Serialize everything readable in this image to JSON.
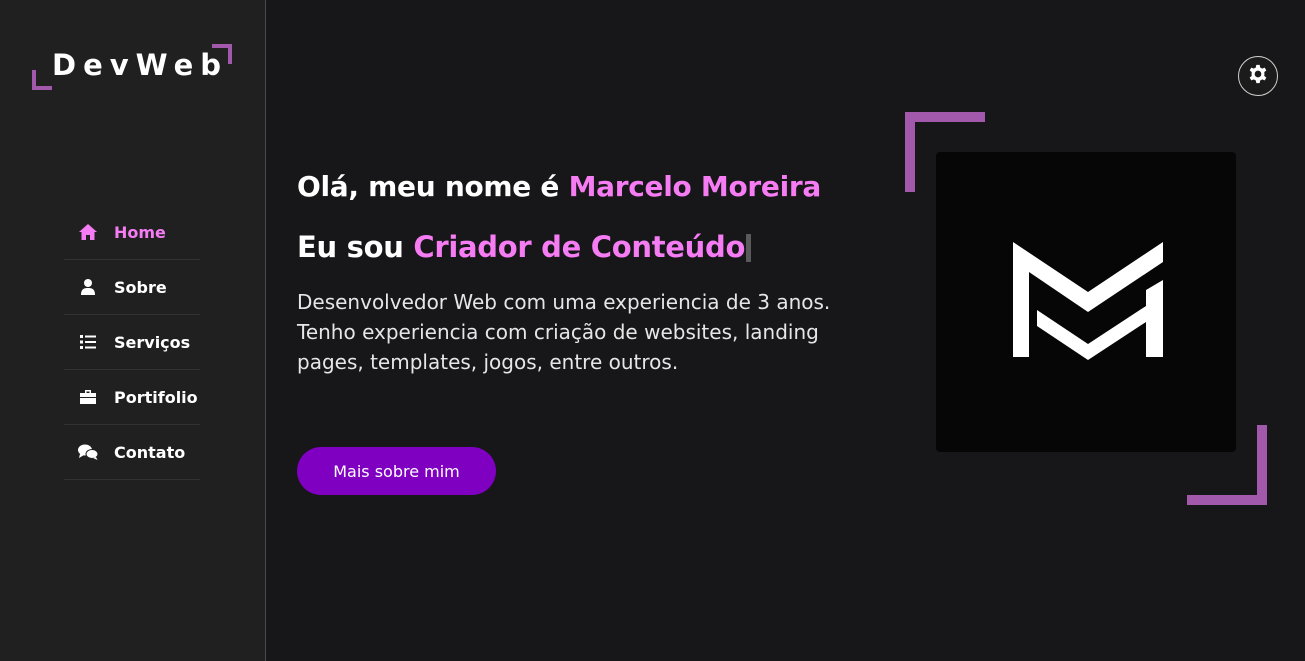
{
  "brand": {
    "name": "DevWeb"
  },
  "sidebar": {
    "items": [
      {
        "label": "Home",
        "icon": "home-icon",
        "active": true
      },
      {
        "label": "Sobre",
        "icon": "user-icon",
        "active": false
      },
      {
        "label": "Serviços",
        "icon": "list-icon",
        "active": false
      },
      {
        "label": "Portifolio",
        "icon": "briefcase-icon",
        "active": false
      },
      {
        "label": "Contato",
        "icon": "chat-icon",
        "active": false
      }
    ]
  },
  "hero": {
    "greeting": "Olá, meu nome é ",
    "name": "Marcelo Moreira",
    "role_prefix": "Eu sou ",
    "role": "Criador de Conteúdo",
    "description": "Desenvolvedor Web com uma experiencia de 3 anos. Tenho experiencia com criação de websites, landing pages, templates, jogos, entre outros.",
    "cta_label": "Mais sobre mim"
  },
  "settings": {
    "icon": "gear-icon"
  },
  "profile": {
    "logo": "MM monogram"
  },
  "colors": {
    "accent": "#f57cf3",
    "frame": "#a259ac",
    "button": "#8000c2",
    "background": "#171618",
    "sidebar": "#212021"
  }
}
